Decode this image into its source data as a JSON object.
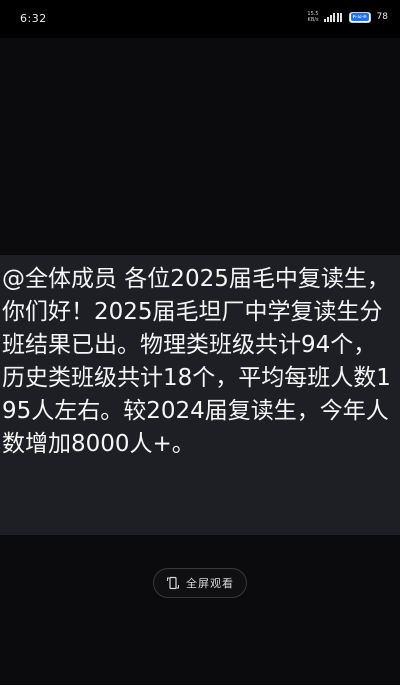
{
  "status_bar": {
    "time": "6:32",
    "net_speed_value": "15.5",
    "net_speed_unit": "KB/s",
    "battery_badge": "ฅ·ω·ฅ",
    "battery_percent": "78",
    "battery_level": 0.78
  },
  "post": {
    "text": "@全体成员 各位2025届毛中复读生，你们好！2025届毛坦厂中学复读生分班结果已出。物理类班级共计94个，历史类班级共计18个，平均每班人数195人左右。较2024届复读生，今年人数增加8000人+。"
  },
  "fullscreen": {
    "label": "全屏观看",
    "icon": "rotate-screen-icon"
  }
}
